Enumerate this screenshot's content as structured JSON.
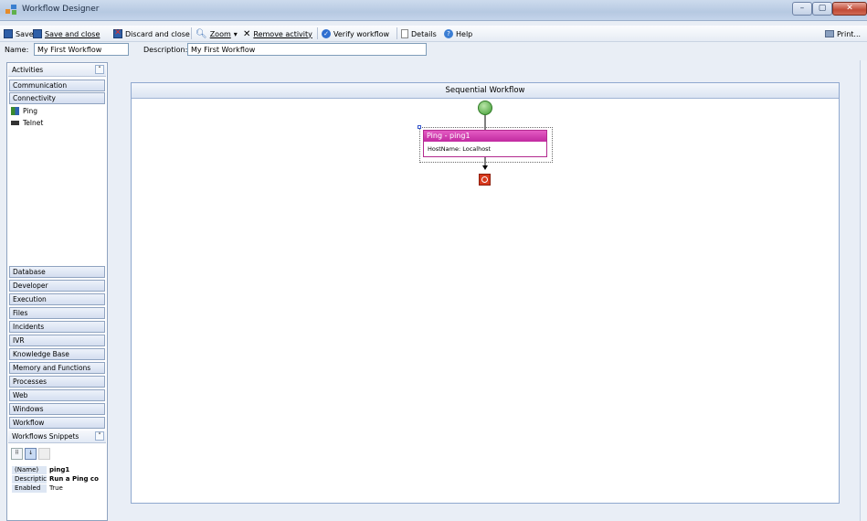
{
  "window": {
    "title": "Workflow Designer"
  },
  "toolbar": {
    "save": "Save",
    "save_close": "Save and close",
    "discard_close": "Discard and close",
    "zoom": "Zoom",
    "remove_activity": "Remove activity",
    "verify": "Verify workflow",
    "details": "Details",
    "help": "Help",
    "print": "Print..."
  },
  "fields": {
    "name_label": "Name:",
    "name_value": "My First Workflow",
    "description_label": "Description:",
    "description_value": "My First Workflow"
  },
  "sidebar": {
    "header": "Activities",
    "top_categories": [
      "Communication",
      "Connectivity"
    ],
    "activities": [
      "Ping",
      "Telnet"
    ],
    "bottom_categories": [
      "Database",
      "Developer",
      "Execution",
      "Files",
      "Incidents",
      "IVR",
      "Knowledge Base",
      "Memory and Functions",
      "Processes",
      "Web",
      "Windows",
      "Workflow"
    ],
    "snippets": "Workflows Snippets"
  },
  "properties": {
    "rows": [
      {
        "key": "(Name)",
        "value": "ping1"
      },
      {
        "key": "Descriptic",
        "value": "Run a Ping co"
      },
      {
        "key": "Enabled",
        "value": "True"
      }
    ]
  },
  "designer": {
    "title": "Sequential Workflow",
    "activity_title": "Ping - ping1",
    "activity_detail": "HostName: Localhost"
  },
  "colors": {
    "activity_header": "#c12aa0",
    "start_node": "#3e9a31",
    "end_node": "#d7391d"
  }
}
